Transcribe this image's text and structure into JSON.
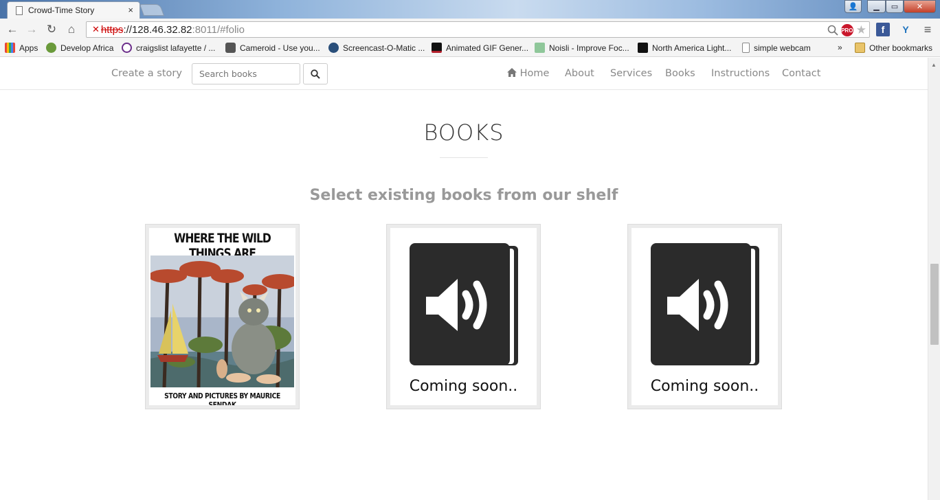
{
  "browser": {
    "tab_title": "Crowd-Time Story",
    "tab_close": "×",
    "url_scheme": "https",
    "url_host": "://128.46.32.82",
    "url_rest": ":8011/#folio",
    "window_controls": {
      "user": "👤",
      "min": "▁",
      "max": "▭",
      "close": "✕"
    },
    "nav": {
      "back": "←",
      "forward": "→",
      "reload": "↻",
      "home": "⌂"
    },
    "menu_icon": "≡",
    "pro_label": "PRO"
  },
  "bookmarks": {
    "items": [
      {
        "label": "Apps",
        "color": "#e8453c"
      },
      {
        "label": "Develop Africa",
        "color": "#6a9a3b"
      },
      {
        "label": "craigslist lafayette / ...",
        "color": "#6b2d8a"
      },
      {
        "label": "Cameroid - Use you...",
        "color": "#555555"
      },
      {
        "label": "Screencast-O-Matic ...",
        "color": "#2a4f7a"
      },
      {
        "label": "Animated GIF Gener...",
        "color": "#b3202c"
      },
      {
        "label": "Noisli - Improve Foc...",
        "color": "#8fc79a"
      },
      {
        "label": "North America Light...",
        "color": "#111111"
      },
      {
        "label": "simple webcam",
        "color": "#ffffff"
      }
    ],
    "overflow": "»",
    "other": "Other bookmarks"
  },
  "site": {
    "brand": "Create a story",
    "search_placeholder": "Search books",
    "menu": [
      "Home",
      "About",
      "Services",
      "Books",
      "Instructions",
      "Contact"
    ]
  },
  "section": {
    "title": "BOOKS",
    "subtitle": "Select existing books from our shelf"
  },
  "books": [
    {
      "cover_title": "WHERE THE WILD THINGS ARE",
      "cover_credit": "STORY AND PICTURES BY MAURICE SENDAK"
    },
    {
      "label": "Coming soon.."
    },
    {
      "label": "Coming soon.."
    }
  ]
}
